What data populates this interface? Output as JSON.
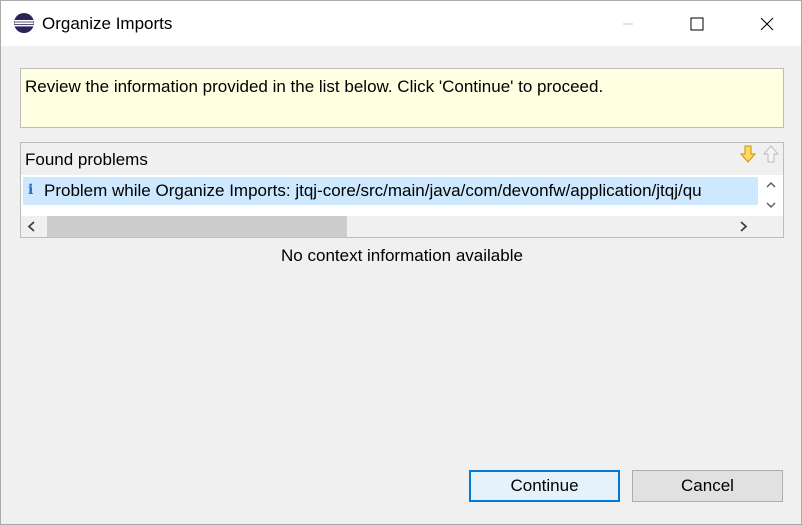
{
  "window": {
    "title": "Organize Imports"
  },
  "info": {
    "message": "Review the information provided in the list below. Click 'Continue' to proceed."
  },
  "problems": {
    "title": "Found problems",
    "rows": [
      {
        "icon": "info-icon",
        "text": "Problem while Organize Imports: jtqj-core/src/main/java/com/devonfw/application/jtqj/qu"
      }
    ]
  },
  "context": {
    "text": "No context information available"
  },
  "buttons": {
    "continue": "Continue",
    "cancel": "Cancel"
  },
  "colors": {
    "info_background": "#ffffe1",
    "selection": "#cde8ff",
    "focus_border": "#0078d7",
    "nav_arrow": "#e8a200"
  }
}
